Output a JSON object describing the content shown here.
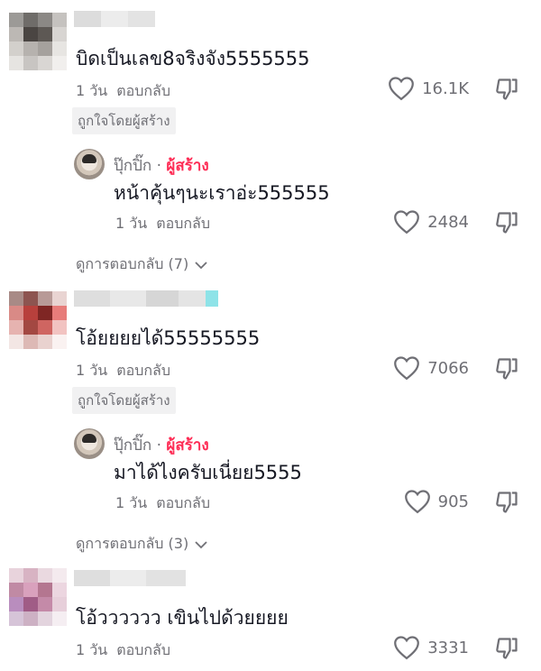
{
  "colors": {
    "text": "#161823",
    "meta": "#6f6f75",
    "creator": "#fe2c55",
    "badge_bg": "#f1f1f2"
  },
  "comments": [
    {
      "text": "บิดเป็นเลข8จริงจัง5555555",
      "time": "1 วัน",
      "reply_label": "ตอบกลับ",
      "likes": "16.1K",
      "badge": "ถูกใจโดยผู้สร้าง",
      "creator_reply": {
        "username": "ปุ๊กปิ๊ก",
        "separator": "·",
        "creator_label": "ผู้สร้าง",
        "text": "หน้าคุ้นๆนะเราอ่ะ555555",
        "time": "1 วัน",
        "reply_label": "ตอบกลับ",
        "likes": "2484"
      },
      "view_replies": "ดูการตอบกลับ (7)"
    },
    {
      "text": "โอ้ยยยยได้55555555",
      "time": "1 วัน",
      "reply_label": "ตอบกลับ",
      "likes": "7066",
      "badge": "ถูกใจโดยผู้สร้าง",
      "creator_reply": {
        "username": "ปุ๊กปิ๊ก",
        "separator": "·",
        "creator_label": "ผู้สร้าง",
        "text": "มาได้ไงครับเนี่ยย5555",
        "time": "1 วัน",
        "reply_label": "ตอบกลับ",
        "likes": "905"
      },
      "view_replies": "ดูการตอบกลับ (3)"
    },
    {
      "text": "โอ้วววววว เขินไปด้วยยยย",
      "time": "1 วัน",
      "reply_label": "ตอบกลับ",
      "likes": "3331"
    }
  ]
}
